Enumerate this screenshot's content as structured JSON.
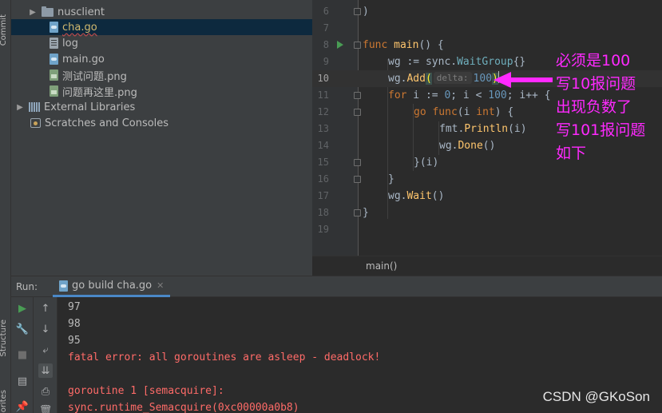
{
  "side_tabs": {
    "commit": "Commit",
    "structure": "Structure",
    "favorites": "orites"
  },
  "project_tree": [
    {
      "name": "nusclient",
      "icon": "folder-icon",
      "kind": "folder",
      "indent": 1
    },
    {
      "name": "cha.go",
      "icon": "go-file-icon",
      "kind": "gofile",
      "indent": 2,
      "selected": true
    },
    {
      "name": "log",
      "icon": "text-file-icon",
      "kind": "textfile",
      "indent": 2
    },
    {
      "name": "main.go",
      "icon": "go-file-icon",
      "kind": "gofile",
      "indent": 2
    },
    {
      "name": "测试问题.png",
      "icon": "image-file-icon",
      "kind": "img",
      "indent": 2
    },
    {
      "name": "问题再这里.png",
      "icon": "image-file-icon",
      "kind": "img",
      "indent": 2
    },
    {
      "name": "External Libraries",
      "icon": "libraries-icon",
      "kind": "lib",
      "indent": 0
    },
    {
      "name": "Scratches and Consoles",
      "icon": "scratches-icon",
      "kind": "scratch",
      "indent": 0
    }
  ],
  "editor": {
    "line_numbers": [
      "6",
      "7",
      "8",
      "9",
      "10",
      "11",
      "12",
      "13",
      "14",
      "15",
      "16",
      "17",
      "18",
      "19"
    ],
    "lines": {
      "l6": ")",
      "l8_kw": "func",
      "l8_fn": "main",
      "l8_rest": "() {",
      "l9_a": "wg := ",
      "l9_b": "sync.",
      "l9_c": "WaitGroup",
      "l9_d": "{}",
      "l10_a": "wg.",
      "l10_b": "Add",
      "l10_c": "(",
      "l10_hint": "delta:",
      "l10_num": "100",
      "l10_close": ")",
      "l11_kw": "for",
      "l11_a": " i := ",
      "l11_n0": "0",
      "l11_b": "; i < ",
      "l11_n100": "100",
      "l11_c": "; i++ {",
      "l12_kw": "go",
      "l12_kw2": "func",
      "l12_a": "(i ",
      "l12_ty": "int",
      "l12_b": ") {",
      "l13_a": "fmt.",
      "l13_b": "Println",
      "l13_c": "(i)",
      "l14_a": "wg.",
      "l14_b": "Done",
      "l14_c": "()",
      "l15": "}(i)",
      "l16": "}",
      "l17_a": "wg.",
      "l17_b": "Wait",
      "l17_c": "()",
      "l18": "}"
    },
    "breadcrumb": "main()"
  },
  "annotation": {
    "lines": [
      "必须是100",
      "写10报问题",
      "出现负数了",
      "写101报问题",
      "如下"
    ],
    "color": "#ff29ff"
  },
  "run_panel": {
    "title": "Run:",
    "tab_label": "go build cha.go",
    "console_lines": [
      {
        "text": "97",
        "type": "out"
      },
      {
        "text": "98",
        "type": "out"
      },
      {
        "text": "95",
        "type": "out"
      },
      {
        "text": "fatal error: all goroutines are asleep - deadlock!",
        "type": "err"
      },
      {
        "text": "",
        "type": "out"
      },
      {
        "text": "goroutine 1 [semacquire]:",
        "type": "err"
      },
      {
        "text": "sync.runtime_Semacquire(0xc00000a0b8)",
        "type": "err"
      }
    ]
  },
  "watermark": "CSDN @GKoSon",
  "colors": {
    "accent": "#4a88c7",
    "error": "#ff6b68",
    "keyword": "#cc7832",
    "function": "#ffc66d",
    "number": "#6897bb",
    "run_green": "#499c54"
  }
}
